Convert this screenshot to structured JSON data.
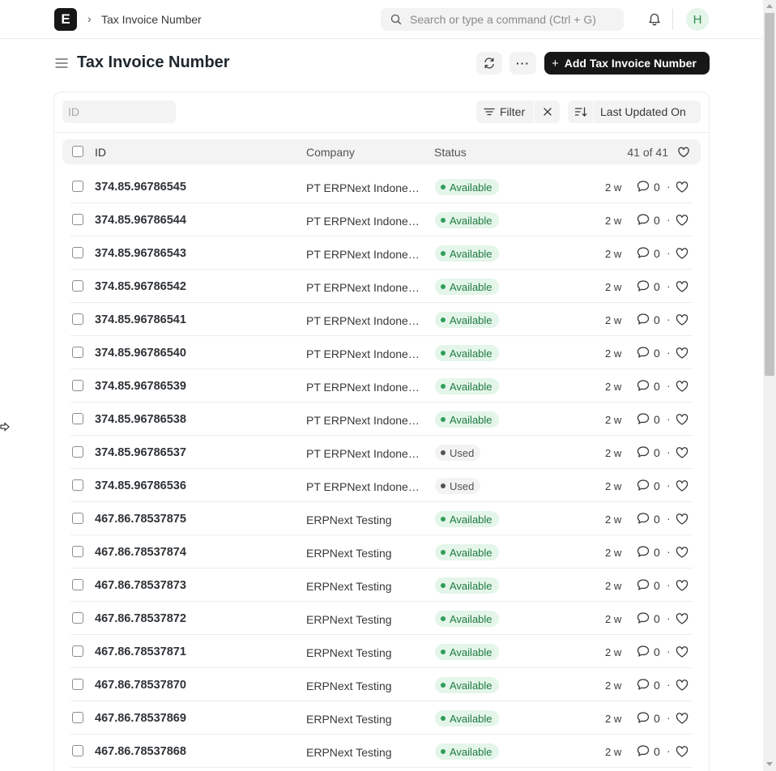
{
  "navbar": {
    "logo_letter": "E",
    "breadcrumb_sep": "›",
    "breadcrumb": "Tax Invoice Number",
    "search_placeholder": "Search or type a command (Ctrl + G)",
    "avatar_initial": "H"
  },
  "page": {
    "title": "Tax Invoice Number",
    "more_label": "···",
    "add_plus": "+",
    "add_label": "Add Tax Invoice Number"
  },
  "filters": {
    "id_placeholder": "ID",
    "filter_label": "Filter",
    "sort_label": "Last Updated On"
  },
  "list": {
    "col_id": "ID",
    "col_company": "Company",
    "col_status": "Status",
    "count": "41 of 41",
    "rows": [
      {
        "id": "374.85.96786545",
        "company": "PT ERPNext Indonesia",
        "status": "Available",
        "time": "2 w",
        "comments": "0"
      },
      {
        "id": "374.85.96786544",
        "company": "PT ERPNext Indonesia",
        "status": "Available",
        "time": "2 w",
        "comments": "0"
      },
      {
        "id": "374.85.96786543",
        "company": "PT ERPNext Indonesia",
        "status": "Available",
        "time": "2 w",
        "comments": "0"
      },
      {
        "id": "374.85.96786542",
        "company": "PT ERPNext Indonesia",
        "status": "Available",
        "time": "2 w",
        "comments": "0"
      },
      {
        "id": "374.85.96786541",
        "company": "PT ERPNext Indonesia",
        "status": "Available",
        "time": "2 w",
        "comments": "0"
      },
      {
        "id": "374.85.96786540",
        "company": "PT ERPNext Indonesia",
        "status": "Available",
        "time": "2 w",
        "comments": "0"
      },
      {
        "id": "374.85.96786539",
        "company": "PT ERPNext Indonesia",
        "status": "Available",
        "time": "2 w",
        "comments": "0"
      },
      {
        "id": "374.85.96786538",
        "company": "PT ERPNext Indonesia",
        "status": "Available",
        "time": "2 w",
        "comments": "0"
      },
      {
        "id": "374.85.96786537",
        "company": "PT ERPNext Indonesia",
        "status": "Used",
        "time": "2 w",
        "comments": "0"
      },
      {
        "id": "374.85.96786536",
        "company": "PT ERPNext Indonesia",
        "status": "Used",
        "time": "2 w",
        "comments": "0"
      },
      {
        "id": "467.86.78537875",
        "company": "ERPNext Testing",
        "status": "Available",
        "time": "2 w",
        "comments": "0"
      },
      {
        "id": "467.86.78537874",
        "company": "ERPNext Testing",
        "status": "Available",
        "time": "2 w",
        "comments": "0"
      },
      {
        "id": "467.86.78537873",
        "company": "ERPNext Testing",
        "status": "Available",
        "time": "2 w",
        "comments": "0"
      },
      {
        "id": "467.86.78537872",
        "company": "ERPNext Testing",
        "status": "Available",
        "time": "2 w",
        "comments": "0"
      },
      {
        "id": "467.86.78537871",
        "company": "ERPNext Testing",
        "status": "Available",
        "time": "2 w",
        "comments": "0"
      },
      {
        "id": "467.86.78537870",
        "company": "ERPNext Testing",
        "status": "Available",
        "time": "2 w",
        "comments": "0"
      },
      {
        "id": "467.86.78537869",
        "company": "ERPNext Testing",
        "status": "Available",
        "time": "2 w",
        "comments": "0"
      },
      {
        "id": "467.86.78537868",
        "company": "ERPNext Testing",
        "status": "Available",
        "time": "2 w",
        "comments": "0"
      }
    ]
  },
  "colors": {
    "primary_button": "#171717",
    "available_bg": "#e4f5e9",
    "available_text": "#1f7a43",
    "used_bg": "#f3f3f3"
  }
}
